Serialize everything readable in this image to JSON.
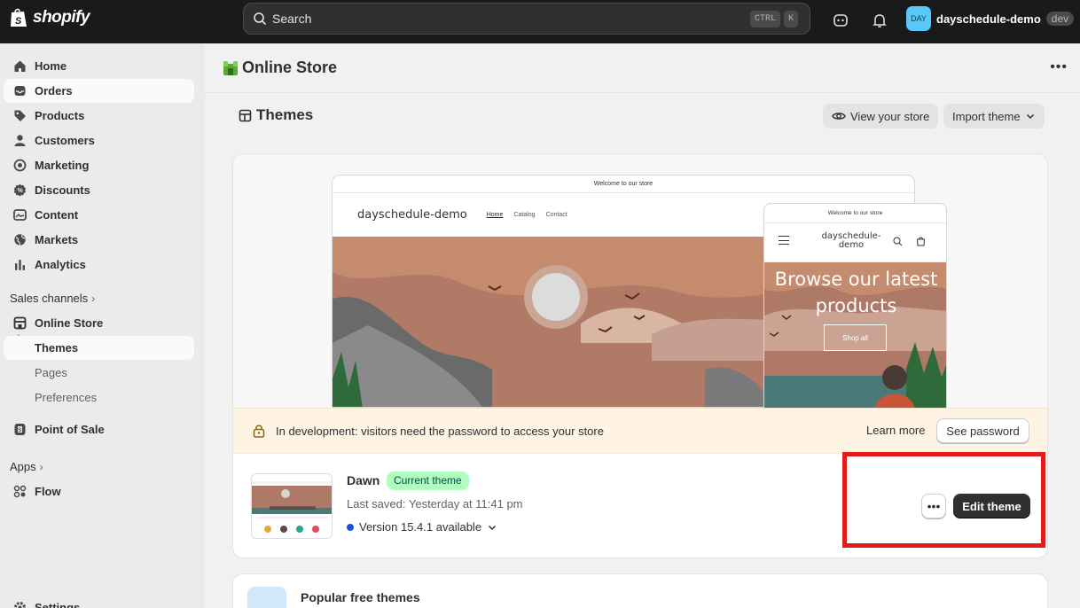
{
  "topbar": {
    "brand": "shopify",
    "search_placeholder": "Search",
    "shortcut_1": "CTRL",
    "shortcut_2": "K",
    "avatar_initials": "DAY",
    "store_name": "dayschedule-demo",
    "env_badge": "dev"
  },
  "sidebar": {
    "items": [
      {
        "label": "Home",
        "icon": "home-icon"
      },
      {
        "label": "Orders",
        "icon": "inbox-icon"
      },
      {
        "label": "Products",
        "icon": "tag-icon"
      },
      {
        "label": "Customers",
        "icon": "person-icon"
      },
      {
        "label": "Marketing",
        "icon": "target-icon"
      },
      {
        "label": "Discounts",
        "icon": "discount-icon"
      },
      {
        "label": "Content",
        "icon": "image-icon"
      },
      {
        "label": "Markets",
        "icon": "globe-icon"
      },
      {
        "label": "Analytics",
        "icon": "bar-chart-icon"
      }
    ],
    "sales_channels_label": "Sales channels",
    "online_store_label": "Online Store",
    "sub_items": [
      "Themes",
      "Pages",
      "Preferences"
    ],
    "point_of_sale_label": "Point of Sale",
    "apps_label": "Apps",
    "flow_label": "Flow",
    "settings_label": "Settings"
  },
  "main": {
    "title": "Online Store",
    "section_title": "Themes",
    "view_store_label": "View your store",
    "import_theme_label": "Import theme",
    "preview": {
      "desktop_banner": "Welcome to our store",
      "desktop_brand": "dayschedule-demo",
      "desktop_links": [
        "Home",
        "Catalog",
        "Contact"
      ],
      "mobile_banner": "Welcome to our store",
      "mobile_brand": "dayschedule-demo",
      "mobile_hero": "Browse our latest products",
      "mobile_button": "Shop all"
    },
    "dev_banner": {
      "text": "In development: visitors need the password to access your store",
      "learn_more": "Learn more",
      "see_password": "See password"
    },
    "theme": {
      "name": "Dawn",
      "badge": "Current theme",
      "saved": "Last saved: Yesterday at 11:41 pm",
      "version": "Version 15.4.1 available",
      "more_label": "•••",
      "edit_label": "Edit theme"
    },
    "popular_title": "Popular free themes"
  },
  "colors": {
    "topbar": "#1a1a1a",
    "badge_green": "#affebf",
    "highlight": "#e11a1a",
    "version_dot": "#1e4fd8"
  }
}
